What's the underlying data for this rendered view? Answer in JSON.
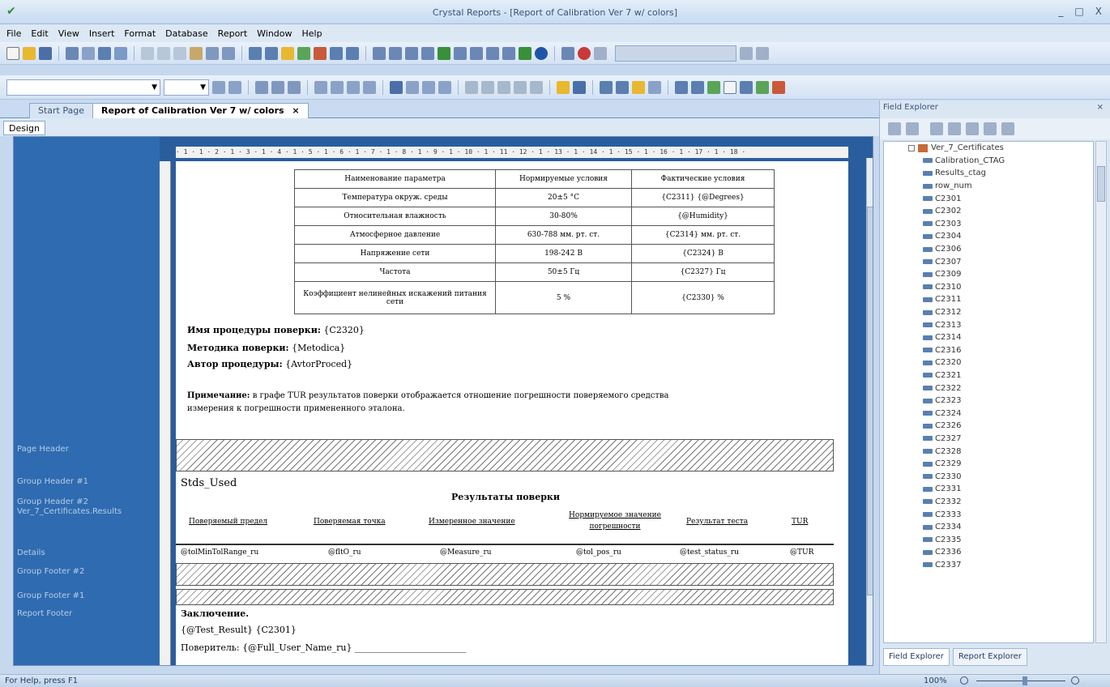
{
  "window": {
    "title": "Crystal Reports - [Report of Calibration Ver 7 w/ colors]",
    "min": "_",
    "max": "□",
    "close": "X"
  },
  "menu": [
    "File",
    "Edit",
    "View",
    "Insert",
    "Format",
    "Database",
    "Report",
    "Window",
    "Help"
  ],
  "tabs": {
    "start": "Start Page",
    "report": "Report of Calibration Ver 7 w/ colors",
    "close": "×"
  },
  "design_tab": "Design",
  "ruler": "· 1 · 1 · 2 · 1 · 3 · 1 · 4 · 1 · 5 · 1 · 6 · 1 · 7 · 1 · 8 · 1 · 9 · 1 · 10 · 1 · 11 · 12 · 1 · 13 · 1 · 14 · 1 · 15 · 1 · 16 · 1 · 17 · 1 · 18 ·",
  "sections": {
    "page_header": "Page Header",
    "group_header_1": "Group Header #1",
    "group_header_2": "Group Header #2",
    "group_header_2b": "Ver_7_Certificates.Results",
    "details": "Details",
    "group_footer_2": "Group Footer #2",
    "group_footer_1": "Group Footer #1",
    "report_footer": "Report Footer"
  },
  "params_table": {
    "headers": [
      "Наименование параметра",
      "Нормируемые условия",
      "Фактические условия"
    ],
    "rows": [
      [
        "Температура окруж. среды",
        "20±5 °C",
        "{C2311} {@Degrees}"
      ],
      [
        "Относительная влажность",
        "30-80%",
        "{@Humidity}"
      ],
      [
        "Атмосферное давление",
        "630-788 мм. рт. ст.",
        "{C2314} мм. рт. ст."
      ],
      [
        "Напряжение сети",
        "198-242 В",
        "{C2324} В"
      ],
      [
        "Частота",
        "50±5 Гц",
        "{C2327} Гц"
      ],
      [
        "Коэффициент нелинейных искажений питания сети",
        "5 %",
        "{C2330} %"
      ]
    ]
  },
  "report_text": {
    "proc_label": "Имя процедуры поверки:",
    "proc_value": "{C2320}",
    "method_label": "Методика поверки:",
    "method_value": "{Metodica}",
    "author_label": "Автор процедуры:",
    "author_value": "{AvtorProced}",
    "note_label": "Примечание:",
    "note_line1": "в графе TUR результатов поверки отображается отношение погрешности поверяемого средства",
    "note_line2": "измерения к погрешности примененного эталона.",
    "stds_used": "Stds_Used",
    "results_title": "Результаты поверки",
    "result_cols": [
      "Поверяемый предел",
      "Поверяемая точка",
      "Измеренное значение",
      "Нормируемое значение погрешности",
      "Результат теста",
      "TUR"
    ],
    "detail_fields": [
      "@tolMinTolRange_ru",
      "@fltO_ru",
      "@Measure_ru",
      "@tol_pos_ru",
      "@test_status_ru",
      "@TUR"
    ],
    "conclusion": "Заключение.",
    "test_result": "{@Test_Result} {C2301}",
    "verifier": "Поверитель: {@Full_User_Name_ru} _________________________"
  },
  "field_explorer": {
    "title": "Field Explorer",
    "pin_close": "⨯",
    "root": "Ver_7_Certificates",
    "items": [
      "Calibration_CTAG",
      "Results_ctag",
      "row_num",
      "C2301",
      "C2302",
      "C2303",
      "C2304",
      "C2306",
      "C2307",
      "C2309",
      "C2310",
      "C2311",
      "C2312",
      "C2313",
      "C2314",
      "C2316",
      "C2320",
      "C2321",
      "C2322",
      "C2323",
      "C2324",
      "C2326",
      "C2327",
      "C2328",
      "C2329",
      "C2330",
      "C2331",
      "C2332",
      "C2333",
      "C2334",
      "C2335",
      "C2336",
      "C2337"
    ],
    "tab_field": "Field Explorer",
    "tab_report": "Report Explorer"
  },
  "status": {
    "help": "For Help, press F1",
    "zoom": "100%"
  }
}
